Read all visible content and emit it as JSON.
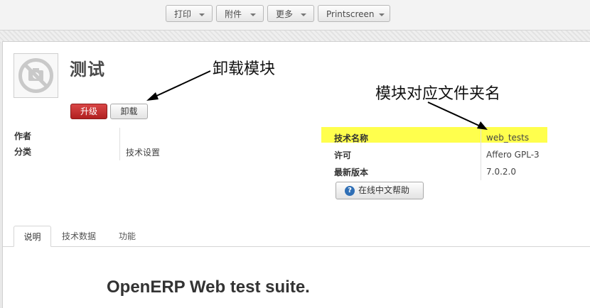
{
  "toolbar": {
    "print": "打印",
    "attachment": "附件",
    "more": "更多",
    "printscreen": "Printscreen"
  },
  "module": {
    "title": "测试",
    "upgrade_label": "升级",
    "uninstall_label": "卸载"
  },
  "fields_left": [
    {
      "label": "作者",
      "value": ""
    },
    {
      "label": "分类",
      "value": "技术设置"
    }
  ],
  "fields_right": [
    {
      "label": "技术名称",
      "value": "web_tests"
    },
    {
      "label": "许可",
      "value": "Affero GPL-3"
    },
    {
      "label": "最新版本",
      "value": "7.0.2.0"
    }
  ],
  "help_button": "在线中文帮助",
  "tabs": [
    {
      "label": "说明",
      "active": true
    },
    {
      "label": "技术数据",
      "active": false
    },
    {
      "label": "功能",
      "active": false
    }
  ],
  "description_heading": "OpenERP Web test suite.",
  "annotations": {
    "uninstall_note": "卸载模块",
    "folder_note": "模块对应文件夹名"
  },
  "colors": {
    "highlight": "#ffff4d",
    "upgrade_button": "#c12a2a"
  }
}
